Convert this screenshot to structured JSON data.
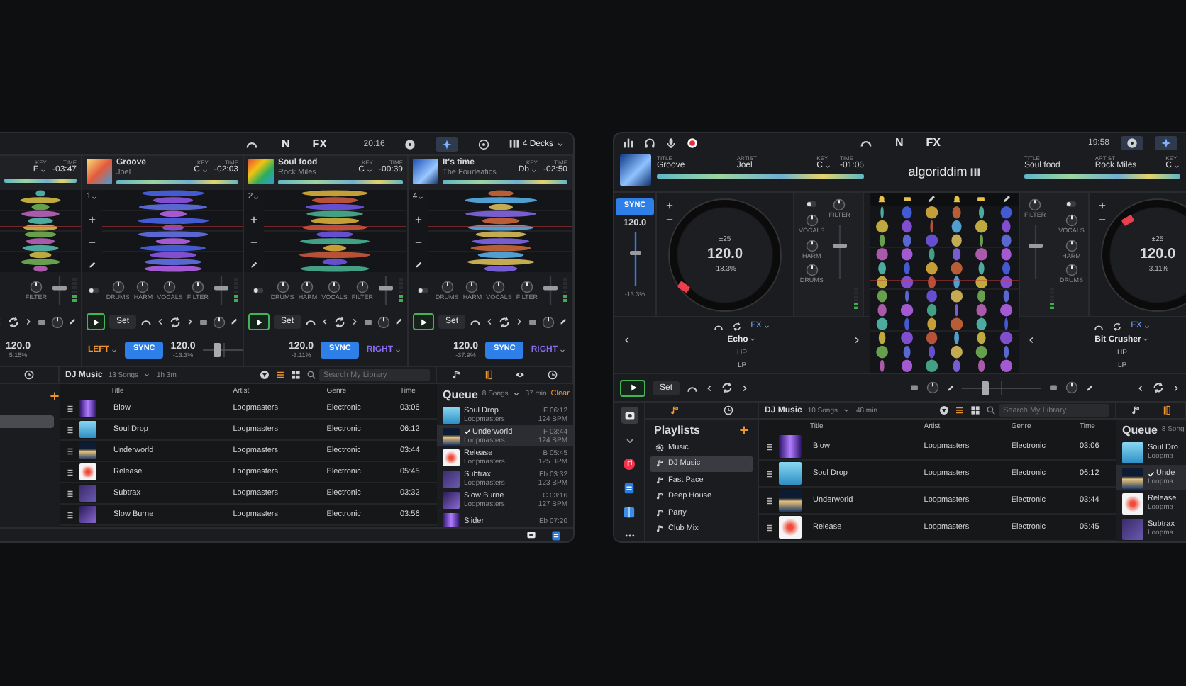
{
  "left_window": {
    "top_bar": {
      "tools": [
        "N",
        "FX"
      ],
      "time": "20:16",
      "views": [
        {
          "selected": false
        },
        {
          "selected": true
        },
        {
          "selected": false
        }
      ],
      "decks_menu": "4 Decks"
    },
    "decks": [
      {
        "kind": "partial",
        "key_label": "KEY",
        "key": "F",
        "time_label": "TIME",
        "time": "-03:47",
        "knobs": [
          "FILTER"
        ],
        "bpm": "120.0",
        "pitch": "5.15%"
      },
      {
        "kind": "left",
        "number": "1",
        "title": "Groove",
        "artist": "Joel",
        "key_label": "KEY",
        "key": "C",
        "time_label": "TIME",
        "time": "-02:03",
        "stems_on": false,
        "knobs": [
          "DRUMS",
          "HARM",
          "VOCALS",
          "FILTER"
        ],
        "set": "Set",
        "bpm": "120.0",
        "pitch": "-13.3%",
        "sync": "SYNC",
        "side": "LEFT"
      },
      {
        "kind": "right",
        "number": "2",
        "title": "Soul food",
        "artist": "Rock Miles",
        "key_label": "KEY",
        "key": "C",
        "time_label": "TIME",
        "time": "-00:39",
        "stems_on": false,
        "knobs": [
          "DRUMS",
          "HARM",
          "VOCALS",
          "FILTER"
        ],
        "set": "Set",
        "bpm": "120.0",
        "pitch": "-3.11%",
        "sync": "SYNC",
        "side": "RIGHT"
      },
      {
        "kind": "right",
        "number": "4",
        "title": "It's time",
        "artist": "The Fourleafics",
        "key_label": "KEY",
        "key": "Db",
        "time_label": "TIME",
        "time": "-02:50",
        "stems_on": false,
        "knobs": [
          "DRUMS",
          "HARM",
          "VOCALS",
          "FILTER"
        ],
        "set": "Set",
        "bpm": "120.0",
        "pitch": "-37.9%",
        "sync": "SYNC",
        "side": "RIGHT"
      }
    ],
    "browser": {
      "playlist": "DJ Music",
      "count": "13 Songs",
      "duration": "1h 3m",
      "search_placeholder": "Search My Library",
      "columns": [
        "Title",
        "Artist",
        "Genre",
        "Time"
      ],
      "rows": [
        {
          "title": "Blow",
          "artist": "Loopmasters",
          "genre": "Electronic",
          "time": "03:06"
        },
        {
          "title": "Soul Drop",
          "artist": "Loopmasters",
          "genre": "Electronic",
          "time": "06:12"
        },
        {
          "title": "Underworld",
          "artist": "Loopmasters",
          "genre": "Electronic",
          "time": "03:44"
        },
        {
          "title": "Release",
          "artist": "Loopmasters",
          "genre": "Electronic",
          "time": "05:45"
        },
        {
          "title": "Subtrax",
          "artist": "Loopmasters",
          "genre": "Electronic",
          "time": "03:32"
        },
        {
          "title": "Slow Burne",
          "artist": "Loopmasters",
          "genre": "Electronic",
          "time": "03:56"
        }
      ]
    },
    "queue": {
      "title": "Queue",
      "count": "8 Songs",
      "duration": "37 min",
      "clear": "Clear",
      "items": [
        {
          "title": "Soul Drop",
          "artist": "Loopmasters",
          "key_time": "F 06:12",
          "bpm": "124 BPM",
          "played": false
        },
        {
          "title": "Underworld",
          "artist": "Loopmasters",
          "key_time": "F 03:44",
          "bpm": "124 BPM",
          "played": true
        },
        {
          "title": "Release",
          "artist": "Loopmasters",
          "key_time": "B 05:45",
          "bpm": "125 BPM",
          "played": false
        },
        {
          "title": "Subtrax",
          "artist": "Loopmasters",
          "key_time": "Eb 03:32",
          "bpm": "123 BPM",
          "played": false
        },
        {
          "title": "Slow Burne",
          "artist": "Loopmasters",
          "key_time": "C 03:16",
          "bpm": "127 BPM",
          "played": false
        },
        {
          "title": "Slider",
          "key_time": "Eb 07:20",
          "played": false
        }
      ]
    }
  },
  "right_window": {
    "top_bar": {
      "tools": [
        "N",
        "FX"
      ],
      "time": "19:58",
      "views": [
        {
          "selected": true
        },
        {
          "selected": true
        }
      ]
    },
    "logo": "algoriddim",
    "decks": [
      {
        "title_label": "TITLE",
        "title": "Groove",
        "artist_label": "ARTIST",
        "artist": "Joel",
        "key_label": "KEY",
        "key": "C",
        "time_label": "TIME",
        "time": "-01:06",
        "sync": "SYNC",
        "bpm": "120.0",
        "pitch": "-13.3%",
        "jog_range": "±25",
        "jog_bpm": "120.0",
        "jog_pitch": "-13.3%",
        "stems_on": false,
        "knobs": [
          "VOCALS",
          "HARM",
          "DRUMS"
        ],
        "filter": "FILTER",
        "fx_menu": "FX",
        "effect": "Echo",
        "fx_params": [
          "HP",
          "LP"
        ],
        "set": "Set"
      },
      {
        "title_label": "TITLE",
        "title": "Soul food",
        "artist_label": "ARTIST",
        "artist": "Rock Miles",
        "key_label": "KEY",
        "key": "C",
        "jog_range": "±25",
        "jog_bpm": "120.0",
        "jog_pitch": "-3.11%",
        "stems_on": false,
        "knobs": [
          "VOCALS",
          "HARM",
          "DRUMS"
        ],
        "filter": "FILTER",
        "fx_menu": "FX",
        "effect": "Bit Crusher",
        "fx_params": [
          "HP",
          "LP"
        ]
      }
    ],
    "sidebar": {
      "title": "Playlists",
      "items": [
        {
          "kind": "library",
          "label": "Music",
          "selected": false
        },
        {
          "kind": "playlist",
          "label": "DJ Music",
          "selected": true
        },
        {
          "kind": "playlist",
          "label": "Fast Pace",
          "selected": false
        },
        {
          "kind": "playlist",
          "label": "Deep House",
          "selected": false
        },
        {
          "kind": "playlist",
          "label": "Party",
          "selected": false
        },
        {
          "kind": "playlist",
          "label": "Club Mix",
          "selected": false
        }
      ]
    },
    "browser": {
      "playlist": "DJ Music",
      "count": "10 Songs",
      "duration": "48 min",
      "search_placeholder": "Search My Library",
      "columns": [
        "Title",
        "Artist",
        "Genre",
        "Time"
      ],
      "rows": [
        {
          "title": "Blow",
          "artist": "Loopmasters",
          "genre": "Electronic",
          "time": "03:06"
        },
        {
          "title": "Soul Drop",
          "artist": "Loopmasters",
          "genre": "Electronic",
          "time": "06:12"
        },
        {
          "title": "Underworld",
          "artist": "Loopmasters",
          "genre": "Electronic",
          "time": "03:44"
        },
        {
          "title": "Release",
          "artist": "Loopmasters",
          "genre": "Electronic",
          "time": "05:45"
        }
      ]
    },
    "queue": {
      "title": "Queue",
      "count": "8 Song",
      "items": [
        {
          "title": "Soul Dro",
          "artist": "Loopma",
          "played": false
        },
        {
          "title": "Unde",
          "artist": "Loopma",
          "played": true
        },
        {
          "title": "Release",
          "artist": "Loopma",
          "played": false
        },
        {
          "title": "Subtrax",
          "artist": "Loopma",
          "played": false
        }
      ]
    }
  }
}
